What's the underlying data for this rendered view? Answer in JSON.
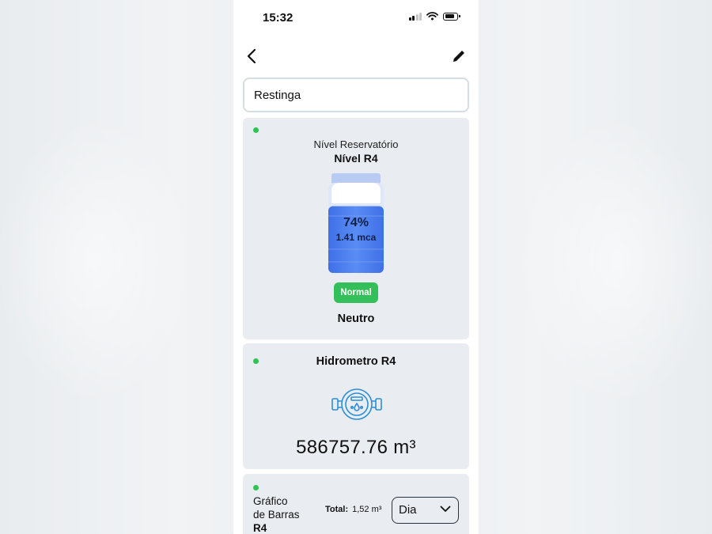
{
  "status_bar": {
    "time": "15:32"
  },
  "location_name": "Restinga",
  "reservoir_card": {
    "subtitle": "Nível Reservatório",
    "title": "Nível R4",
    "level_percent": "74%",
    "level_fraction": 0.74,
    "level_mca": "1.41 mca",
    "status_badge": "Normal",
    "status_text": "Neutro"
  },
  "meter_card": {
    "title": "Hidrometro R4",
    "reading": "586757.76 m³"
  },
  "chart_card": {
    "title_line1": "Gráfico",
    "title_line2": "de Barras",
    "title_line3": "R4",
    "total_label": "Total:",
    "total_value": "1,52 m³",
    "period_selected": "Dia"
  },
  "colors": {
    "accent_green": "#33bf59",
    "indicator_green": "#2fc254",
    "water_blue": "#4b7ff0",
    "card_bg": "#e9ecf0"
  },
  "icons": [
    "back-icon",
    "edit-icon",
    "water-meter-icon",
    "chevron-down-icon",
    "signal-icon",
    "wifi-icon",
    "battery-icon"
  ]
}
